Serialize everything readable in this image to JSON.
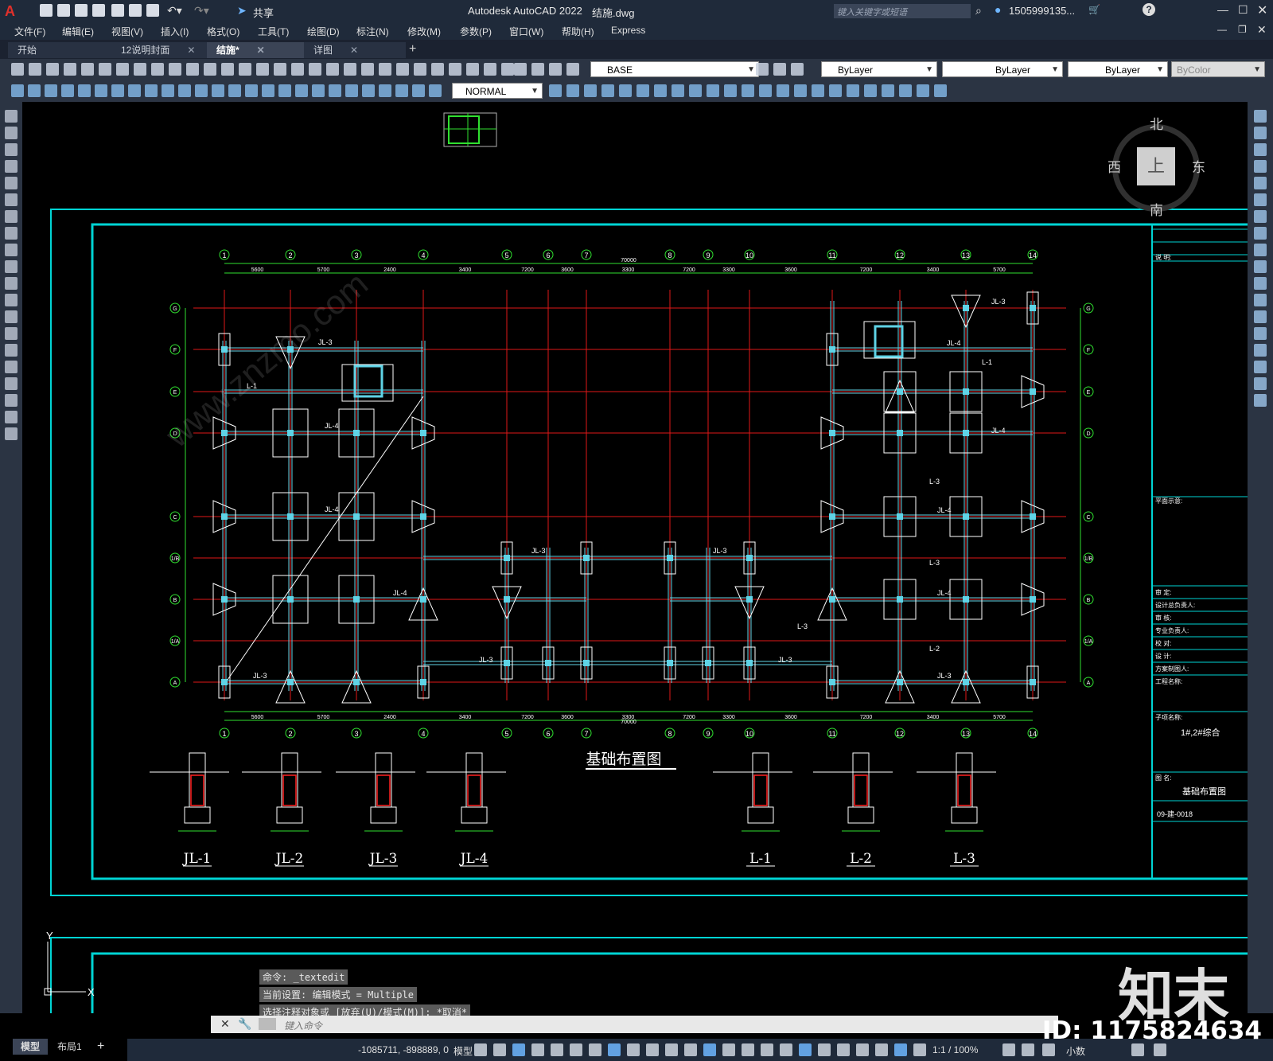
{
  "app": {
    "title": "Autodesk AutoCAD 2022",
    "filename": "结施.dwg",
    "search_placeholder": "键入关键字或短语",
    "user": "1505999135...",
    "share_label": "共享"
  },
  "menu": [
    "文件(F)",
    "编辑(E)",
    "视图(V)",
    "插入(I)",
    "格式(O)",
    "工具(T)",
    "绘图(D)",
    "标注(N)",
    "修改(M)",
    "参数(P)",
    "窗口(W)",
    "帮助(H)",
    "Express"
  ],
  "tabs": [
    {
      "label": "开始",
      "active": false
    },
    {
      "label": "12说明封面",
      "active": false
    },
    {
      "label": "结施*",
      "active": true
    },
    {
      "label": "详图",
      "active": false
    }
  ],
  "toolbar": {
    "layer": "BASE",
    "color": "ByLayer",
    "linetype": "ByLayer",
    "lineweight": "ByLayer",
    "plotstyle": "ByColor",
    "textstyle": "NORMAL"
  },
  "viewcube": {
    "north": "北",
    "south": "南",
    "east": "东",
    "west": "西",
    "face": "上"
  },
  "drawing": {
    "title": "基础布置图",
    "top_axes": [
      "1",
      "2",
      "3",
      "4",
      "5",
      "6",
      "7",
      "8",
      "9",
      "10",
      "11",
      "12",
      "13",
      "14"
    ],
    "side_axes": [
      "G",
      "F",
      "E",
      "D",
      "C",
      "1/B",
      "B",
      "1/A",
      "A"
    ],
    "top_dims": [
      "5600",
      "5700",
      "2400",
      "3400",
      "7200",
      "3600",
      "3300",
      "7200",
      "3300",
      "3600",
      "7200",
      "3400",
      "5700",
      "5600"
    ],
    "overall_dim": "70000",
    "section_labels": [
      "JL-1",
      "JL-2",
      "JL-3",
      "JL-4",
      "L-1",
      "L-2",
      "L-3"
    ],
    "titleblock": {
      "project_name_label": "子项名称:",
      "project_name": "1#,2#综合",
      "drawing_name_label": "图 名:",
      "drawing_name": "基础布置图",
      "drawing_no": "09-建-0018",
      "rows": [
        "审 定:",
        "设计总负责人:",
        "审 核:",
        "专业负责人:",
        "校 对:",
        "设 计:",
        "方案制图人:",
        "工程名称:"
      ],
      "top_label": "说 明:",
      "plan_label": "平面示意:"
    }
  },
  "command": {
    "history": [
      "命令: _textedit",
      "当前设置: 编辑模式 = Multiple",
      "选择注释对象或 [放弃(U)/模式(M)]: *取消*"
    ],
    "input_placeholder": "键入命令"
  },
  "layout_tabs": [
    "模型",
    "布局1"
  ],
  "status": {
    "coords": "-1085711, -898889, 0",
    "space": "模型",
    "scale": "1:1 / 100%",
    "units": "小数"
  },
  "watermark": {
    "id": "ID: 1175824634",
    "logo": "知末",
    "site": "www.znzmo.com"
  }
}
